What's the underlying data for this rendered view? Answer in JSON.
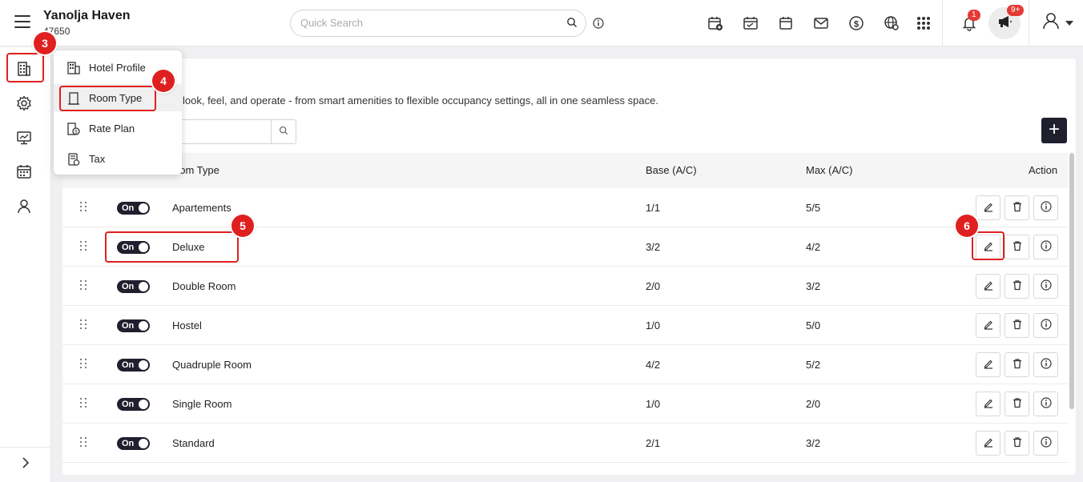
{
  "header": {
    "hotel_name": "Yanolja Haven",
    "hotel_id": "47650",
    "search_placeholder": "Quick Search",
    "notification_count": "1",
    "announcement_count": "9+"
  },
  "nav_menu": {
    "items": [
      {
        "label": "Hotel Profile",
        "icon": "hotel-profile-icon"
      },
      {
        "label": "Room Type",
        "icon": "door-icon"
      },
      {
        "label": "Rate Plan",
        "icon": "rate-plan-icon"
      },
      {
        "label": "Tax",
        "icon": "tax-icon"
      }
    ],
    "active": "Room Type"
  },
  "page": {
    "description": "look, feel, and operate - from smart amenities to flexible occupancy settings, all in one seamless space.",
    "add_label": "+"
  },
  "table": {
    "columns": {
      "room_type": "oom Type",
      "base": "Base (A/C)",
      "max": "Max (A/C)",
      "action": "Action"
    },
    "rows": [
      {
        "status": "On",
        "name": "Apartements",
        "base": "1/1",
        "max": "5/5"
      },
      {
        "status": "On",
        "name": "Deluxe",
        "base": "3/2",
        "max": "4/2"
      },
      {
        "status": "On",
        "name": "Double Room",
        "base": "2/0",
        "max": "3/2"
      },
      {
        "status": "On",
        "name": "Hostel",
        "base": "1/0",
        "max": "5/0"
      },
      {
        "status": "On",
        "name": "Quadruple Room",
        "base": "4/2",
        "max": "5/2"
      },
      {
        "status": "On",
        "name": "Single Room",
        "base": "1/0",
        "max": "2/0"
      },
      {
        "status": "On",
        "name": "Standard",
        "base": "2/1",
        "max": "3/2"
      }
    ]
  },
  "annotations": {
    "step3": "3",
    "step4": "4",
    "step5": "5",
    "step6": "6",
    "color": "#e02020"
  }
}
